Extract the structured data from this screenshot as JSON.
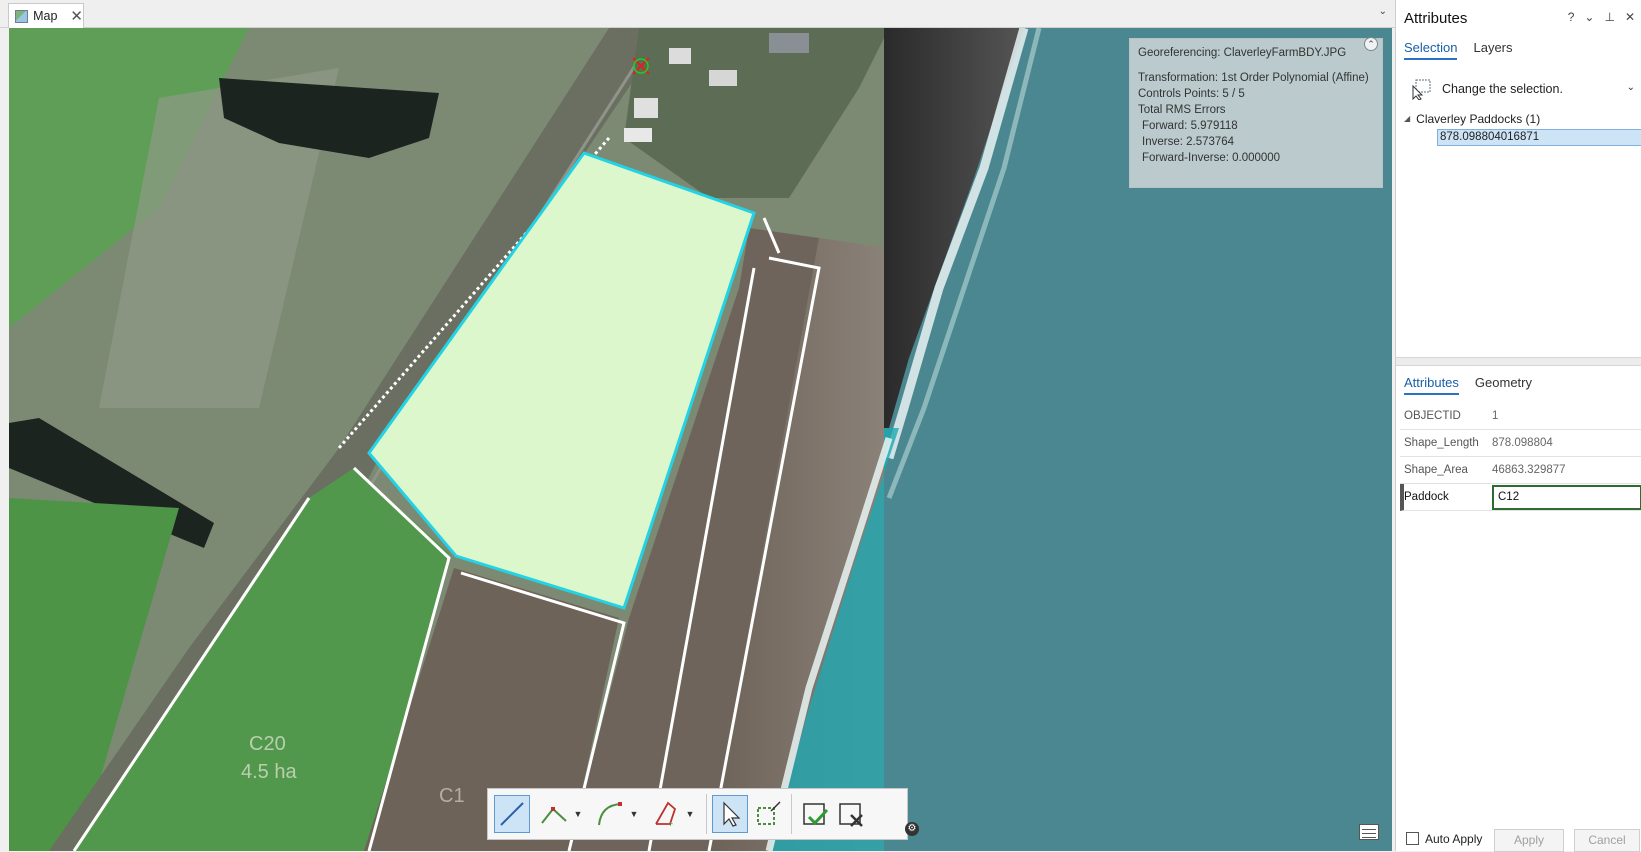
{
  "map_tab": {
    "label": "Map"
  },
  "georef": {
    "title": "Georeferencing: ClaverleyFarmBDY.JPG",
    "transformation": "Transformation: 1st Order Polynomial (Affine)",
    "control_points": "Controls Points: 5 / 5",
    "rms_header": "Total RMS Errors",
    "forward": "Forward: 5.979118",
    "inverse": "Inverse: 2.573764",
    "forward_inverse": "Forward-Inverse: 0.000000"
  },
  "map_labels": {
    "label_a_line1": "C20",
    "label_a_line2": "4.5 ha",
    "label_b": "C1"
  },
  "attributes_pane": {
    "title": "Attributes",
    "controls": {
      "help": "?",
      "menu": "⌄",
      "pin": "⊥",
      "close": "✕"
    },
    "top_tabs": [
      "Selection",
      "Layers"
    ],
    "change_selection": "Change the selection.",
    "tree_group": "Claverley Paddocks (1)",
    "tree_feature": "878.098804016871",
    "bottom_tabs": [
      "Attributes",
      "Geometry"
    ],
    "fields": [
      {
        "name": "OBJECTID",
        "value": "1"
      },
      {
        "name": "Shape_Length",
        "value": "878.098804"
      },
      {
        "name": "Shape_Area",
        "value": "46863.329877"
      },
      {
        "name": "Paddock",
        "value": "C12"
      }
    ],
    "auto_apply": "Auto Apply",
    "auto_apply_checked": false,
    "apply": "Apply",
    "cancel": "Cancel"
  },
  "colors": {
    "selected_polygon_fill": "#dcf7cc",
    "selected_polygon_outline": "#22d3e6",
    "active_tab_accent": "#2a72c4",
    "sea": "#4b8790"
  },
  "toolbar_icons": [
    "line-tool-icon",
    "polyline-tool-icon",
    "arc-tool-icon",
    "right-angle-tool-icon",
    "select-arrow-icon",
    "select-rectangle-icon",
    "finish-sketch-icon",
    "clear-sketch-icon"
  ]
}
